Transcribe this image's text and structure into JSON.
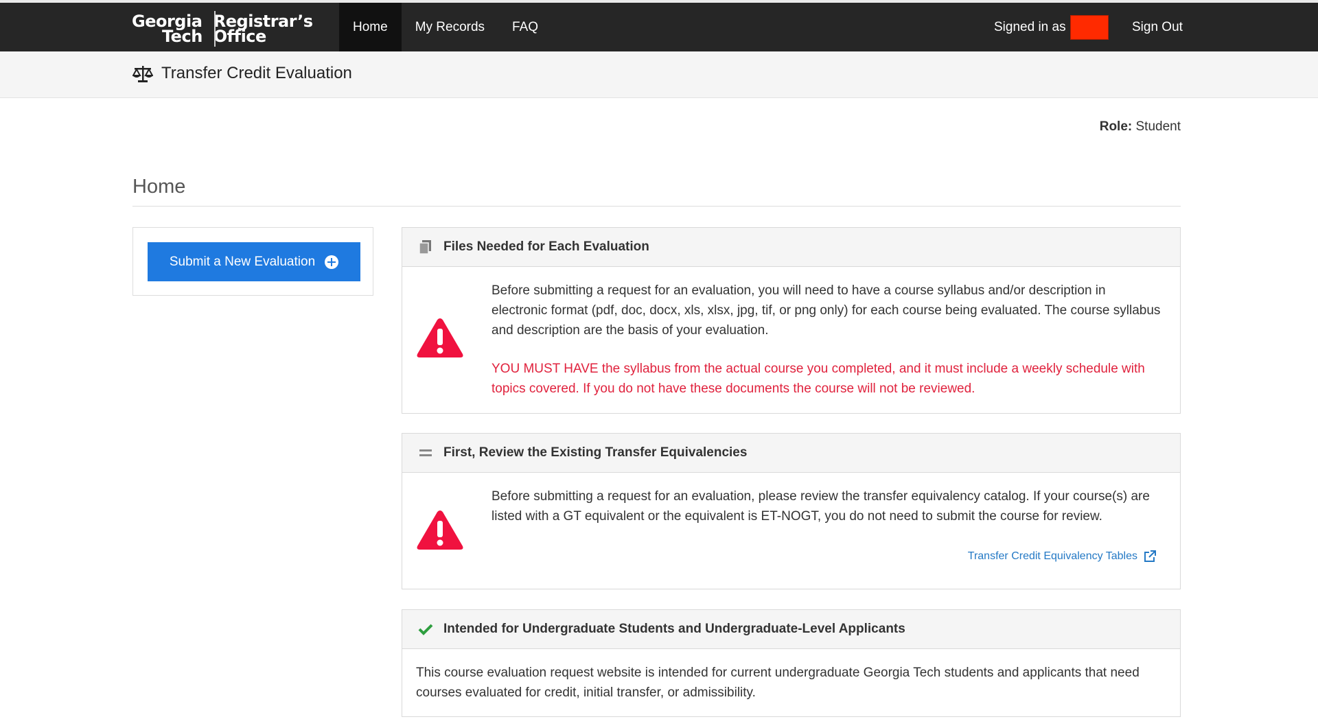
{
  "brand": {
    "logo_line1_left": "Georgia",
    "logo_line2_left": "Tech",
    "logo_line1_right": "Registrar’s",
    "logo_line2_right": "Office"
  },
  "nav": {
    "items": [
      {
        "label": "Home",
        "active": true
      },
      {
        "label": "My Records",
        "active": false
      },
      {
        "label": "FAQ",
        "active": false
      }
    ],
    "signed_in_label": "Signed in as",
    "sign_out_label": "Sign Out"
  },
  "subheader": {
    "title": "Transfer Credit Evaluation",
    "icon": "balance-scale-icon"
  },
  "role": {
    "label": "Role:",
    "value": "Student"
  },
  "page_title": "Home",
  "sidebar": {
    "submit_button_label": "Submit a New Evaluation",
    "submit_button_icon": "plus-circle-icon"
  },
  "panels": {
    "files": {
      "title": "Files Needed for Each Evaluation",
      "icon": "files-icon",
      "text": "Before submitting a request for an evaluation, you will need to have a course syllabus and/or description in electronic format (pdf, doc, docx, xls, xlsx, jpg, tif, or png only) for each course being evaluated. The course syllabus and description are the basis of your evaluation.",
      "warning_text": "YOU MUST HAVE the syllabus from the actual course you completed, and it must include a weekly schedule with topics covered. If you do not have these documents the course will not be reviewed."
    },
    "review": {
      "title": "First, Review the Existing Transfer Equivalencies",
      "icon": "equals-icon",
      "text": "Before submitting a request for an evaluation, please review the transfer equivalency catalog. If your course(s) are listed with a GT equivalent or the equivalent is ET-NOGT, you do not need to submit the course for review.",
      "link_label": "Transfer Credit Equivalency Tables",
      "link_icon": "external-link-icon"
    },
    "intended": {
      "title": "Intended for Undergraduate Students and Undergraduate-Level Applicants",
      "icon": "checkmark-icon",
      "text": "This course evaluation request website is intended for current undergraduate Georgia Tech students and applicants that need courses evaluated for credit, initial transfer, or admissibility."
    }
  },
  "colors": {
    "nav_bg": "#262626",
    "accent_blue": "#1f7ae0",
    "warning_red": "#e0223d",
    "check_green": "#2e9e3f",
    "link_blue": "#2479c5"
  }
}
